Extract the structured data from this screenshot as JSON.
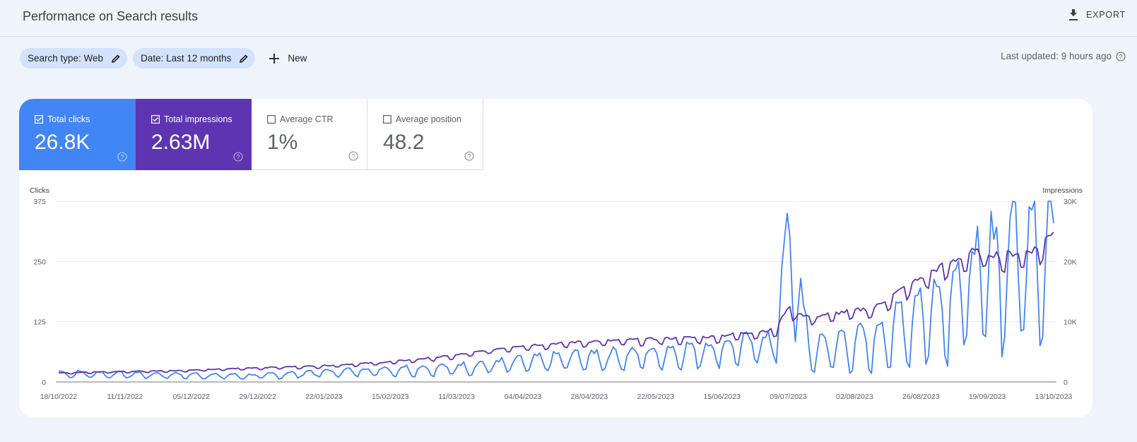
{
  "header": {
    "title": "Performance on Search results",
    "export_label": "EXPORT"
  },
  "filters": {
    "chips": [
      {
        "label": "Search type: Web"
      },
      {
        "label": "Date: Last 12 months"
      }
    ],
    "new_label": "New",
    "last_updated": "Last updated: 9 hours ago"
  },
  "metrics": [
    {
      "label": "Total clicks",
      "value": "26.8K",
      "checked": true,
      "color": "#4285f4"
    },
    {
      "label": "Total impressions",
      "value": "2.63M",
      "checked": true,
      "color": "#5e35b1"
    },
    {
      "label": "Average CTR",
      "value": "1%",
      "checked": false
    },
    {
      "label": "Average position",
      "value": "48.2",
      "checked": false
    }
  ],
  "chart_data": {
    "type": "line",
    "left_axis": {
      "title": "Clicks",
      "ticks": [
        "0",
        "125",
        "250",
        "375"
      ],
      "range": [
        0,
        375
      ]
    },
    "right_axis": {
      "title": "Impressions",
      "ticks": [
        "0",
        "10K",
        "20K",
        "30K"
      ],
      "range": [
        0,
        30000
      ]
    },
    "x_ticks": [
      "18/10/2022",
      "11/11/2022",
      "05/12/2022",
      "29/12/2022",
      "22/01/2023",
      "15/02/2023",
      "11/03/2023",
      "04/04/2023",
      "28/04/2023",
      "22/05/2023",
      "15/06/2023",
      "09/07/2023",
      "02/08/2023",
      "26/08/2023",
      "19/09/2023",
      "13/10/2023"
    ],
    "grid": true,
    "series": [
      {
        "name": "Clicks",
        "axis": "left",
        "color": "#4285f4",
        "weekly_pattern_note": "daily values, strong weekly dips",
        "anchors": [
          [
            0,
            20
          ],
          [
            24,
            18
          ],
          [
            48,
            16
          ],
          [
            72,
            14
          ],
          [
            96,
            22
          ],
          [
            120,
            28
          ],
          [
            144,
            32
          ],
          [
            168,
            44
          ],
          [
            192,
            56
          ],
          [
            216,
            62
          ],
          [
            240,
            75
          ],
          [
            264,
            92
          ],
          [
            268,
            350
          ],
          [
            276,
            80
          ],
          [
            300,
            100
          ],
          [
            312,
            150
          ],
          [
            324,
            190
          ],
          [
            336,
            250
          ],
          [
            348,
            300
          ],
          [
            360,
            340
          ],
          [
            366,
            310
          ]
        ]
      },
      {
        "name": "Impressions",
        "axis": "right",
        "color": "#5e35b1",
        "anchors": [
          [
            0,
            1500
          ],
          [
            24,
            1700
          ],
          [
            48,
            1900
          ],
          [
            72,
            2300
          ],
          [
            96,
            2600
          ],
          [
            120,
            3200
          ],
          [
            144,
            4200
          ],
          [
            168,
            5800
          ],
          [
            192,
            6500
          ],
          [
            216,
            6900
          ],
          [
            240,
            7300
          ],
          [
            264,
            8500
          ],
          [
            268,
            12000
          ],
          [
            276,
            10500
          ],
          [
            300,
            12000
          ],
          [
            312,
            15500
          ],
          [
            324,
            18500
          ],
          [
            336,
            21000
          ],
          [
            348,
            20500
          ],
          [
            360,
            21500
          ],
          [
            366,
            24500
          ]
        ]
      }
    ]
  }
}
